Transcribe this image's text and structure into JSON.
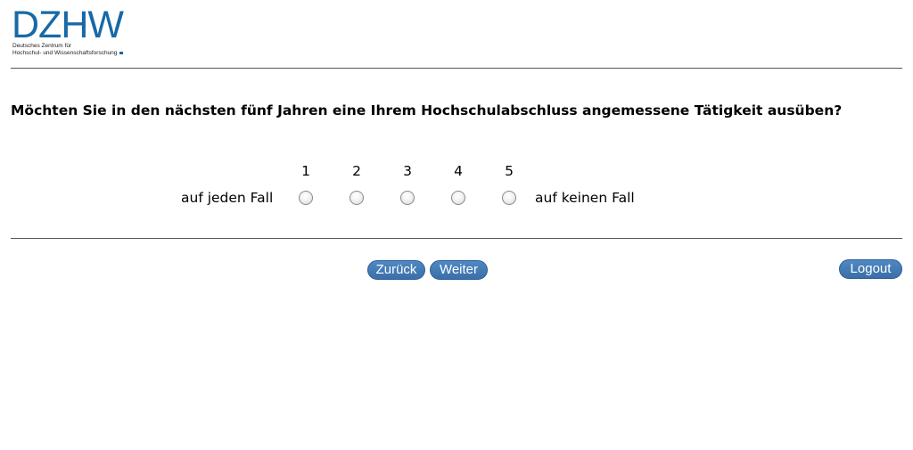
{
  "logo": {
    "mark": "DZHW",
    "subtitle_line1": "Deutsches Zentrum für",
    "subtitle_line2": "Hochschul- und Wissenschaftsforschung"
  },
  "question": {
    "text": "Möchten Sie in den nächsten fünf Jahren eine Ihrem Hochschulabschluss angemessene Tätigkeit ausüben?"
  },
  "scale": {
    "numbers": [
      "1",
      "2",
      "3",
      "4",
      "5"
    ],
    "left_label": "auf jeden Fall",
    "right_label": "auf keinen Fall",
    "selected": null
  },
  "navigation": {
    "back_label": "Zurück",
    "next_label": "Weiter",
    "logout_label": "Logout"
  },
  "colors": {
    "brand": "#1769a7",
    "button": "#3f74ad"
  }
}
